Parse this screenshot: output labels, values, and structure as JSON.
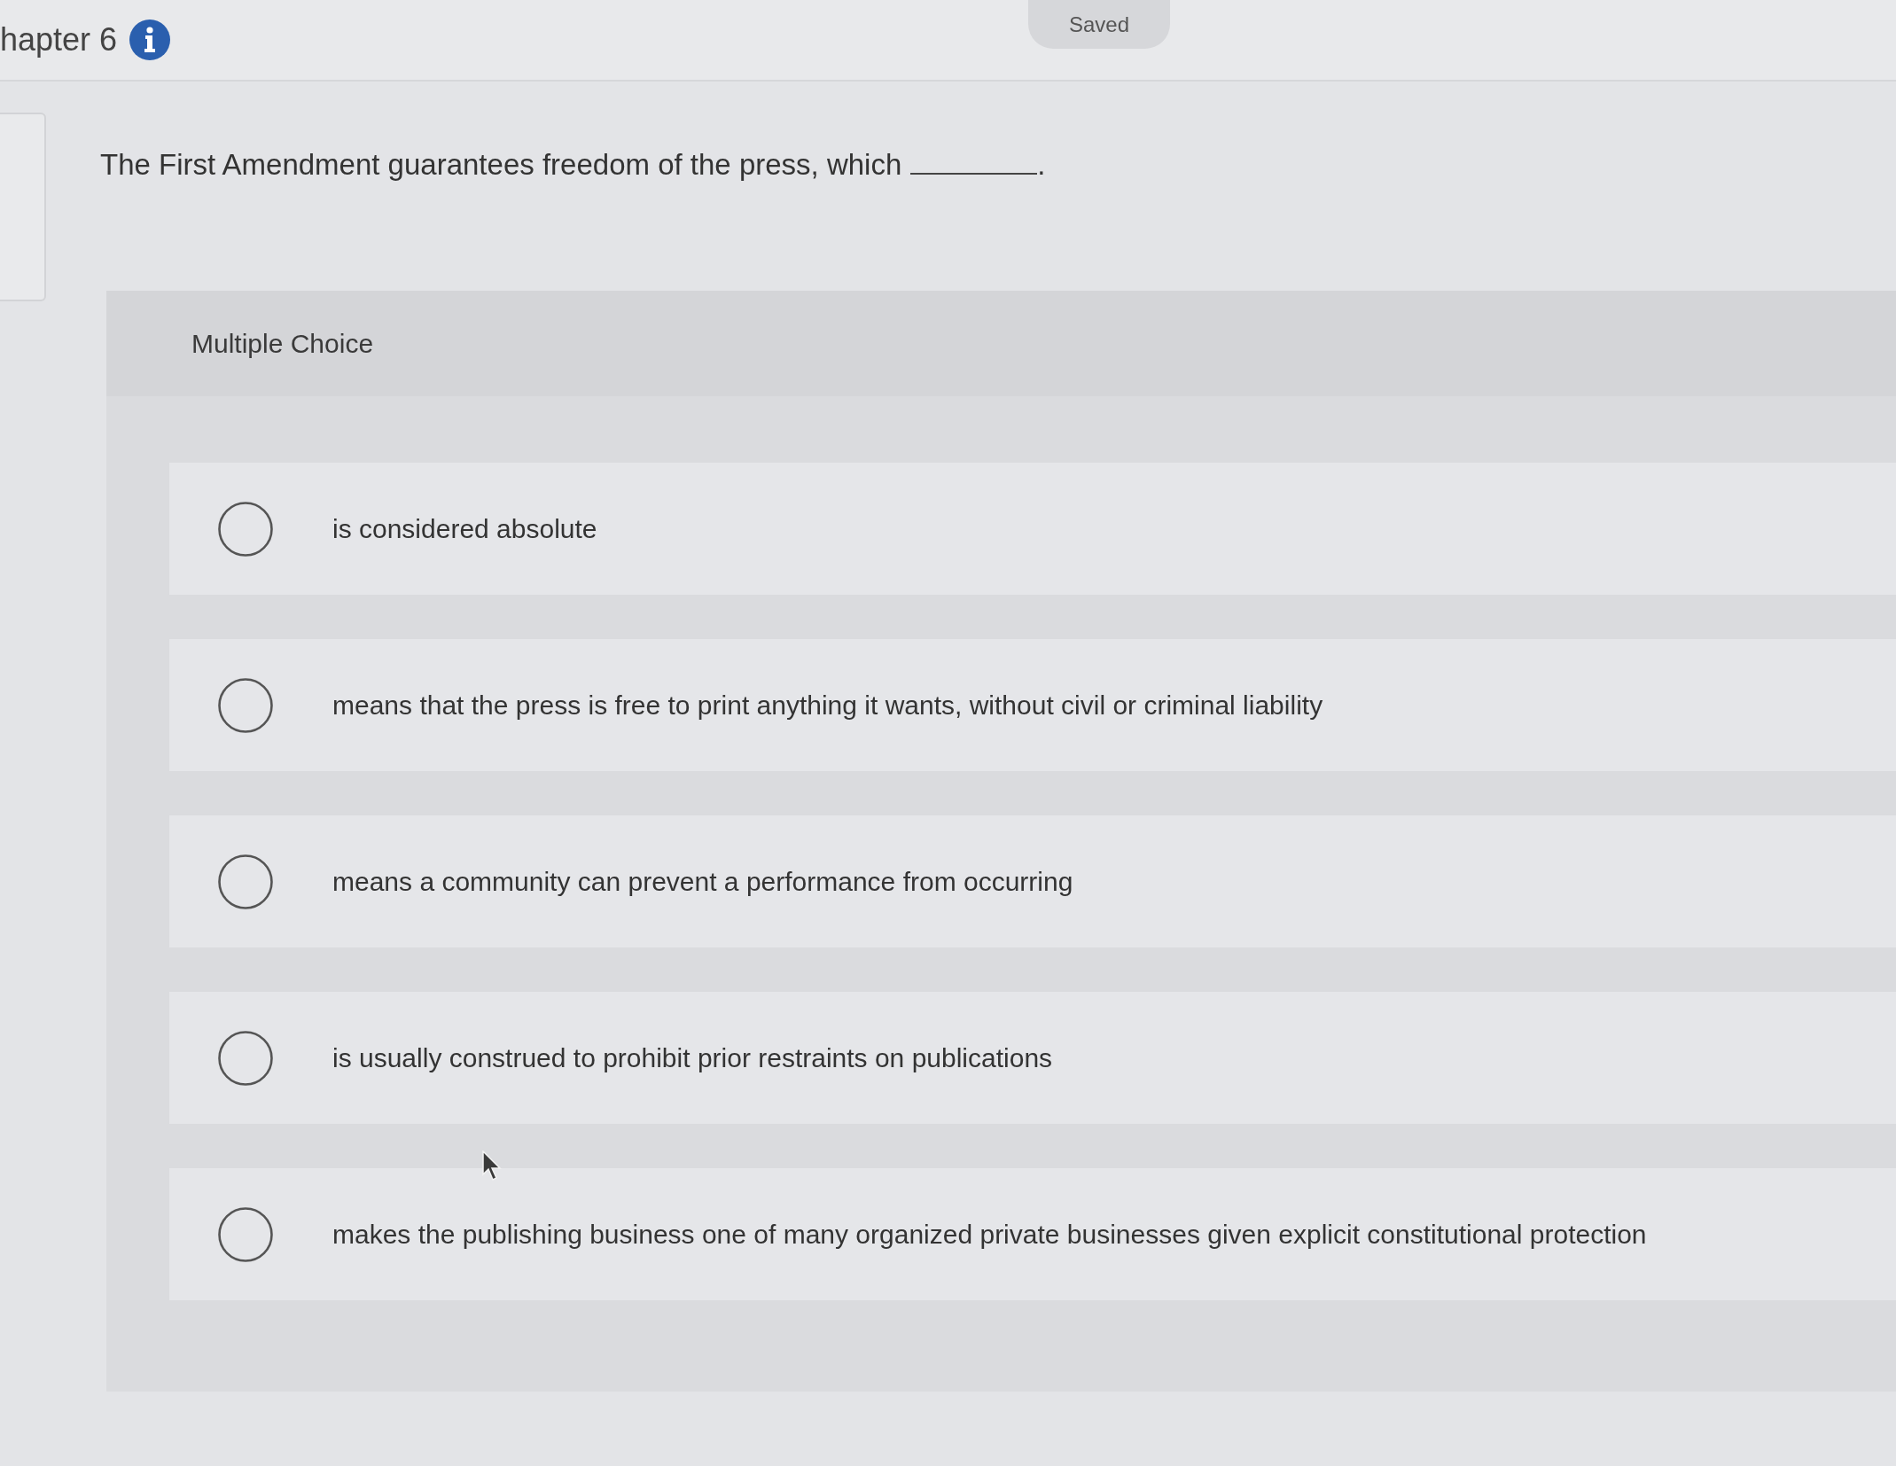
{
  "header": {
    "title": "hapter 6",
    "save_status": "Saved"
  },
  "question": {
    "parts": [
      {
        "kind": "text",
        "text": "The First Amendment guarantees freedom of the press, which"
      },
      {
        "kind": "blank"
      },
      {
        "kind": "text",
        "text": "."
      }
    ]
  },
  "answer_section": {
    "label": "Multiple Choice",
    "options": [
      {
        "text": "is considered absolute",
        "selected": false
      },
      {
        "text": "means that the press is free to print anything it wants, without civil or criminal liability",
        "selected": false
      },
      {
        "text": "means a community can prevent a performance from occurring",
        "selected": false
      },
      {
        "text": "is usually construed to prohibit prior restraints on publications",
        "selected": false
      },
      {
        "text": "makes the publishing business one of many organized private businesses given explicit constitutional protection",
        "selected": false
      }
    ]
  }
}
